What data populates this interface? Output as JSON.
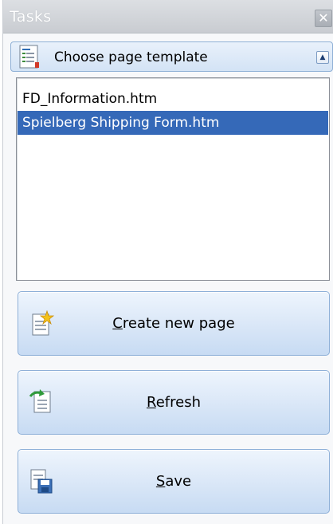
{
  "window": {
    "title": "Tasks",
    "close_glyph": "✕"
  },
  "section": {
    "title": "Choose page template",
    "icon": "page-template-icon",
    "collapse_glyph": "▲"
  },
  "templates": {
    "items": [
      "FD_Information.htm",
      "Spielberg Shipping Form.htm"
    ],
    "selected_index": 1
  },
  "actions": [
    {
      "label": "Create new page",
      "icon": "new-page-icon"
    },
    {
      "label": "Refresh",
      "icon": "refresh-icon"
    },
    {
      "label": "Save",
      "icon": "save-icon"
    }
  ],
  "colors": {
    "selection": "#3569b8",
    "header_border": "#8fb0d6"
  }
}
